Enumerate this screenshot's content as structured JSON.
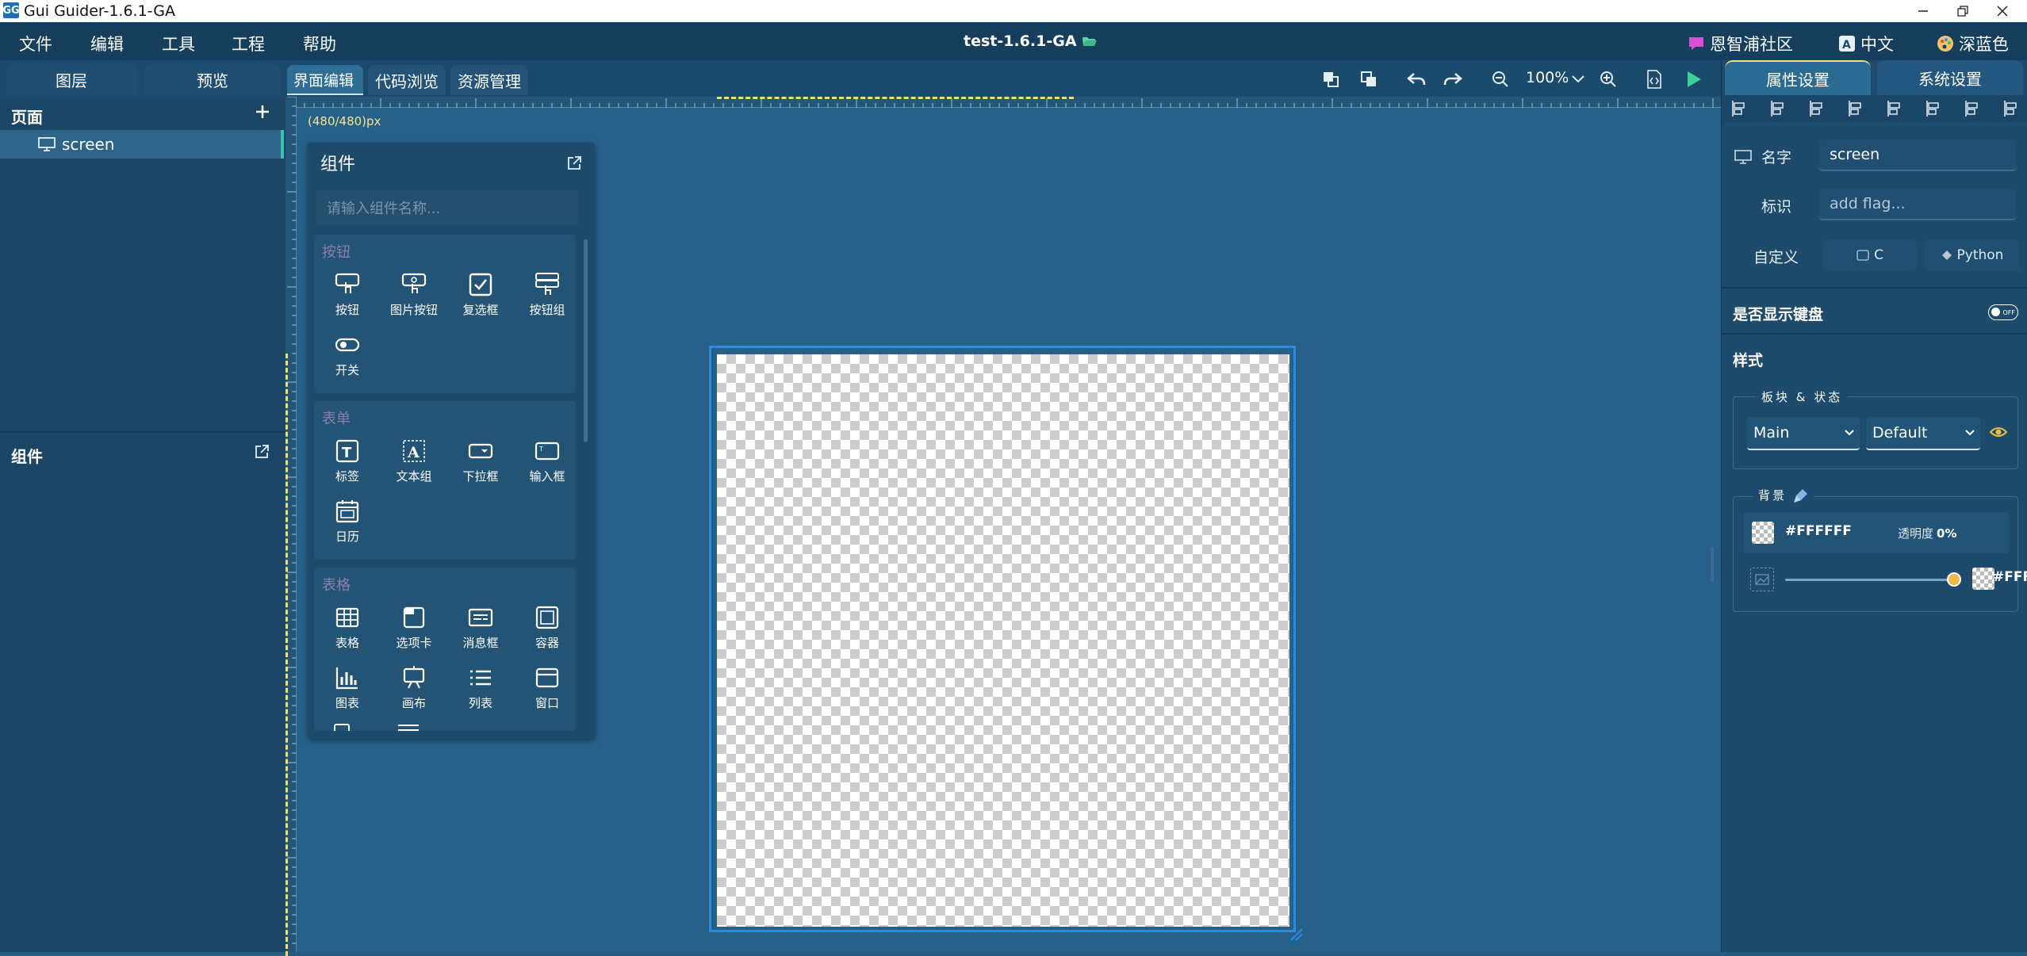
{
  "titlebar": {
    "title": "Gui Guider-1.6.1-GA",
    "app_icon": "GG"
  },
  "menu": {
    "items": [
      "文件",
      "编辑",
      "工具",
      "工程",
      "帮助"
    ],
    "project_title": "test-1.6.1-GA",
    "community": "恩智浦社区",
    "language": "中文",
    "theme": "深蓝色"
  },
  "left_tabs": {
    "layers": "图层",
    "preview": "预览"
  },
  "editor_tabs": {
    "ui_edit": "界面编辑",
    "code_browse": "代码浏览",
    "resource_mgmt": "资源管理"
  },
  "toolbar": {
    "zoom": "100%"
  },
  "pages_panel": {
    "title": "页面",
    "screen_name": "screen"
  },
  "components_panel": {
    "title": "组件"
  },
  "canvas": {
    "size_label": "(480/480)px"
  },
  "component_window": {
    "title": "组件",
    "search_placeholder": "请输入组件名称...",
    "groups": [
      {
        "title": "按钮",
        "items": [
          "按钮",
          "图片按钮",
          "复选框",
          "按钮组",
          "开关"
        ]
      },
      {
        "title": "表单",
        "items": [
          "标签",
          "文本组",
          "下拉框",
          "输入框",
          "日历"
        ]
      },
      {
        "title": "表格",
        "items": [
          "表格",
          "选项卡",
          "消息框",
          "容器",
          "图表",
          "画布",
          "列表",
          "窗口"
        ]
      }
    ]
  },
  "right_panel": {
    "tabs": {
      "properties": "属性设置",
      "system": "系统设置"
    },
    "name_label": "名字",
    "name_value": "screen",
    "flag_label": "标识",
    "flag_placeholder": "add flag...",
    "custom_label": "自定义",
    "custom_c": "C",
    "custom_python": "Python",
    "keyboard_label": "是否显示键盘",
    "keyboard_toggle": "OFF",
    "style_label": "样式",
    "block_state_label": "板块 & 状态",
    "part_select": "Main",
    "state_select": "Default",
    "bg_label": "背景",
    "bg_color": "#FFFFFF",
    "opacity_label": "透明度",
    "opacity_value": "0%",
    "grad_color": "#FFFFFF"
  },
  "colors": {
    "accent": "#38c4b0",
    "bg": "#255b7e",
    "selection": "#2b8bdc",
    "slider_knob": "#f0b94a"
  }
}
